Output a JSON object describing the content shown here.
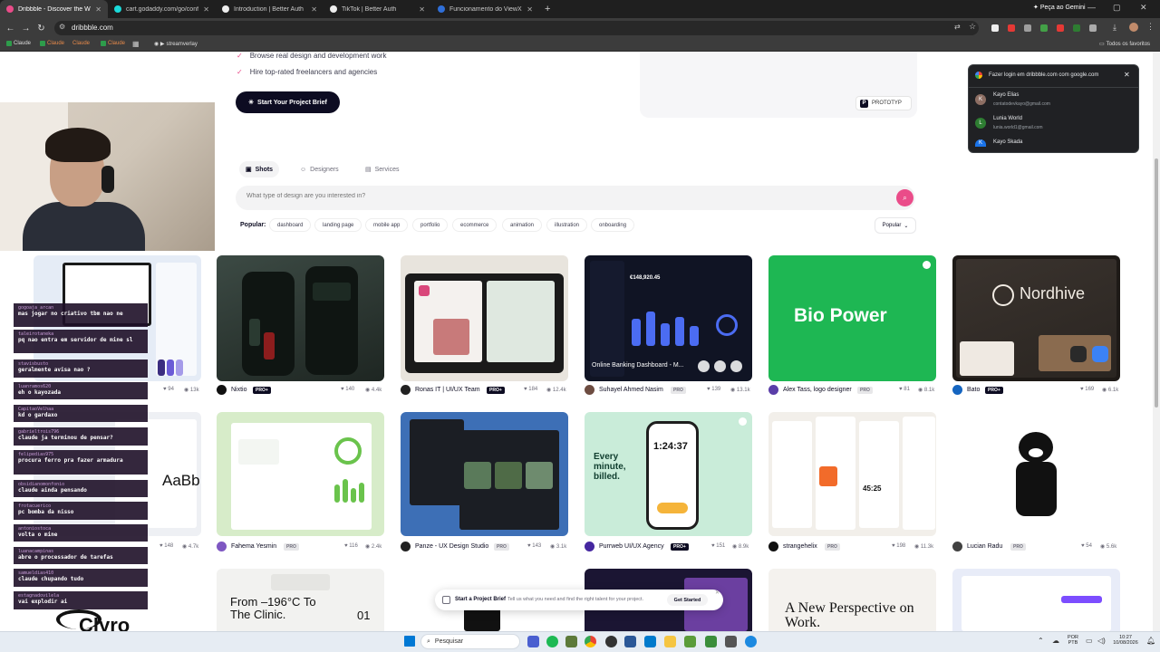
{
  "browser": {
    "tabs": [
      {
        "title": "Dribbble - Discover the World's",
        "color": "#ea4c89",
        "active": true
      },
      {
        "title": "cart.godaddy.com/go/confirm",
        "color": "#1bdbdb",
        "active": false
      },
      {
        "title": "Introduction | Better Auth",
        "color": "#111111",
        "active": false
      },
      {
        "title": "TikTok | Better Auth",
        "color": "#111111",
        "active": false
      },
      {
        "title": "Funcionamento do ViewX",
        "color": "#2f6fd8",
        "active": false
      }
    ],
    "new_tab": "+",
    "gemini": "Peça ao Gemini",
    "url": "dribbble.com",
    "bookmarks": [
      "Claude",
      "Claude",
      "Claude",
      "Claude",
      "streamverlay"
    ],
    "all_favorites": "Todos os favoritos"
  },
  "page": {
    "bullets": [
      "Browse real design and development work",
      "Hire top-rated freelancers and agencies"
    ],
    "start_button": "Start Your Project Brief",
    "prototype_badge": "PROTOTYP",
    "tabs": {
      "shots": "Shots",
      "designers": "Designers",
      "services": "Services"
    },
    "search_placeholder": "What type of design are you interested in?",
    "popular_label": "Popular:",
    "chips": [
      "dashboard",
      "landing page",
      "mobile app",
      "portfolio",
      "ecommerce",
      "animation",
      "illustration",
      "onboarding"
    ],
    "sort": "Popular"
  },
  "shots_row1": [
    {
      "name": "",
      "badge": "",
      "likes": "94",
      "views": "13k"
    },
    {
      "name": "Nixtio",
      "badge": "PRO+",
      "likes": "140",
      "views": "4.4k"
    },
    {
      "name": "Ronas IT | UI/UX Team",
      "badge": "PRO+",
      "likes": "184",
      "views": "12.4k"
    },
    {
      "name": "Suhayel Ahmed Nasim",
      "badge": "PRO",
      "likes": "139",
      "views": "13.1k"
    },
    {
      "name": "Alex Tass, logo designer",
      "badge": "PRO",
      "likes": "81",
      "views": "8.1k"
    },
    {
      "name": "Bato",
      "badge": "PRO+",
      "likes": "169",
      "views": "6.1k"
    }
  ],
  "shots_row2": [
    {
      "name": "",
      "badge": "",
      "likes": "148",
      "views": "4.7k"
    },
    {
      "name": "Fahema Yesmin",
      "badge": "PRO",
      "likes": "116",
      "views": "2.4k"
    },
    {
      "name": "Panze - UX Design Studio",
      "badge": "PRO",
      "likes": "143",
      "views": "3.1k"
    },
    {
      "name": "Purrweb UI/UX Agency",
      "badge": "PRO+",
      "likes": "151",
      "views": "8.9k"
    },
    {
      "name": "strangehelix",
      "badge": "PRO",
      "likes": "198",
      "views": "11.3k"
    },
    {
      "name": "Lucian Radu",
      "badge": "PRO",
      "likes": "54",
      "views": "5.6k"
    }
  ],
  "shot_texts": {
    "biopower": "Bio Power",
    "nordhive": "Nordhive",
    "banking": "Online Banking Dashboard - M...",
    "balance": "€148,920.45",
    "every_minute": "Every minute, billed.",
    "timer": "1:24:37",
    "route_time": "45:25",
    "clinic": "From –196°C To The Clinic.",
    "clinic_num": "01",
    "perspective": "A New Perspective on Work.",
    "clyro": "Clyro",
    "aabb": "AaBb"
  },
  "float_bar": {
    "title": "Start a Project Brief",
    "text": "Tell us what you need and find the right talent for your project.",
    "button": "Get Started"
  },
  "google_popup": {
    "title": "Fazer login em dribbble.com com google.com",
    "accounts": [
      {
        "initial": "K",
        "name": "Kayo Elias",
        "email": "contatodevkayo@gmail.com",
        "color": "#8d6e63"
      },
      {
        "initial": "L",
        "name": "Lunia World",
        "email": "lunia.world1@gmail.com",
        "color": "#2e7d32"
      },
      {
        "initial": "K",
        "name": "Kayo Skada",
        "email": "",
        "color": "#1a73e8"
      }
    ]
  },
  "chat": [
    {
      "user": "gogoaja_arcan",
      "msg": "mas jogar no criativo tbm nao ne"
    },
    {
      "user": "taleirotaneka",
      "msg": "pq nao entra em servidor de mine sl"
    },
    {
      "user": "stavisbusto",
      "msg": "geralmente avisa nao ?"
    },
    {
      "user": "luanramos620",
      "msg": "eh o kayozada"
    },
    {
      "user": "CapitaoVelhaa",
      "msg": "kd o gardaxo"
    },
    {
      "user": "gabrieltrois796",
      "msg": "claude ja terminou de pensar?"
    },
    {
      "user": "felipedias975",
      "msg": "procura ferro pra fazer armadura"
    },
    {
      "user": "obsidianomonfonio",
      "msg": "claude ainda pensando"
    },
    {
      "user": "frotacuerico",
      "msg": "pc bomba da nisso"
    },
    {
      "user": "antoniostoca",
      "msg": "volta o mine"
    },
    {
      "user": "luanacampinas",
      "msg": "abre o processador de tarefas"
    },
    {
      "user": "samueldias410",
      "msg": "claude chupando tudo"
    },
    {
      "user": "estagnadovilela",
      "msg": "vai explodir ai"
    }
  ],
  "taskbar": {
    "search": "Pesquisar",
    "lang1": "POR",
    "lang2": "PTB",
    "time": "10:27",
    "date": "10/08/2026"
  }
}
